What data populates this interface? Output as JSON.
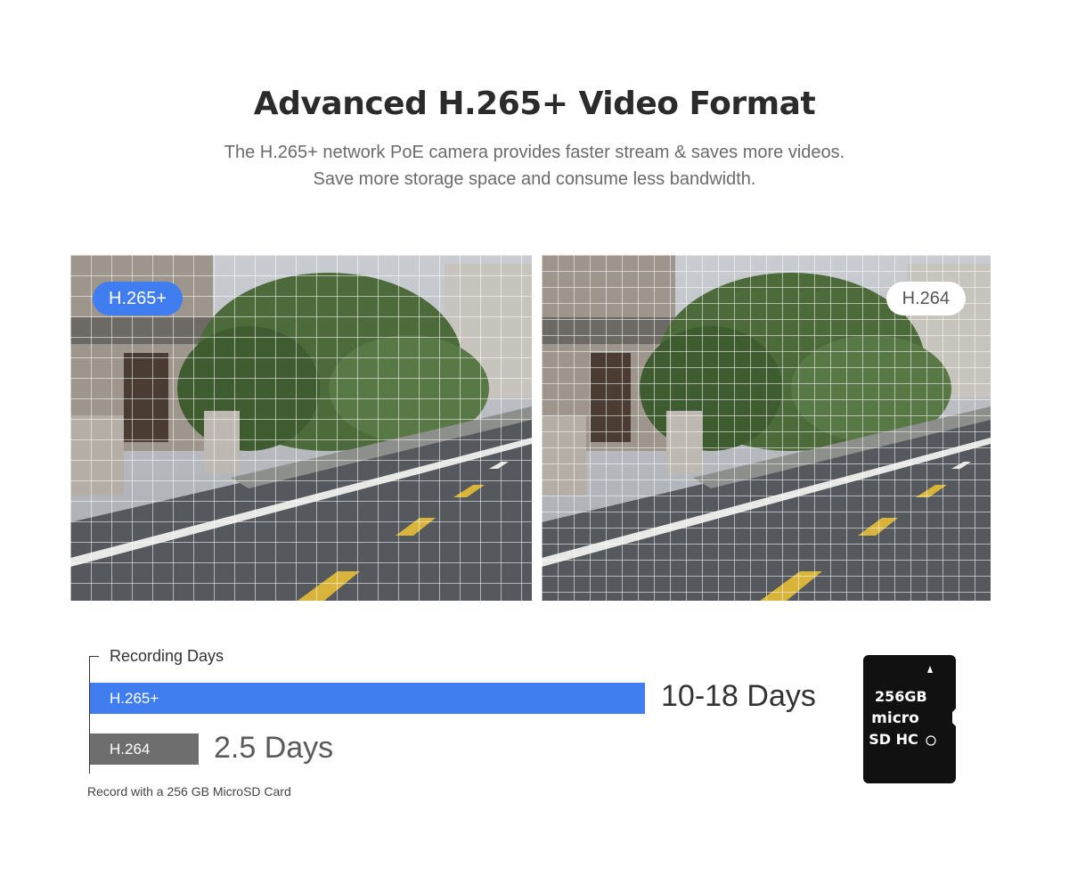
{
  "header": {
    "title": "Advanced H.265+ Video Format",
    "subtitle_line1": "The H.265+ network PoE camera provides faster stream & saves more videos.",
    "subtitle_line2": "Save more storage space and consume less bandwidth."
  },
  "comparison": {
    "left_label": "H.265+",
    "right_label": "H.264"
  },
  "chart_data": {
    "type": "bar",
    "title": "Recording Days",
    "categories": [
      "H.265+",
      "H.264"
    ],
    "value_labels": [
      "10-18 Days",
      "2.5 Days"
    ],
    "values": [
      18,
      2.5
    ],
    "footnote": "Record with a 256 GB MicroSD Card",
    "colors": [
      "#3f7df0",
      "#6e6e6e"
    ]
  },
  "sdcard": {
    "capacity": "256GB",
    "brand_line": "micro",
    "type_line": "SD HC"
  }
}
